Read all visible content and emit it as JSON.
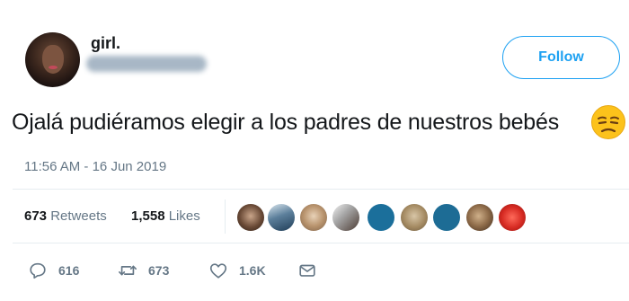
{
  "user": {
    "display_name": "girl."
  },
  "follow_button": {
    "label": "Follow"
  },
  "tweet": {
    "text": "Ojalá pudiéramos elegir a los padres de nuestros bebés",
    "emoji": "unamused-face",
    "timestamp": "11:56 AM - 16 Jun 2019"
  },
  "stats": {
    "retweets_count": "673",
    "retweets_label": "Retweets",
    "likes_count": "1,558",
    "likes_label": "Likes"
  },
  "actions": {
    "reply_count": "616",
    "retweet_count": "673",
    "like_count": "1.6K"
  },
  "colors": {
    "accent": "#1da1f2",
    "secondary_text": "#657786",
    "divider": "#e6ecf0"
  }
}
